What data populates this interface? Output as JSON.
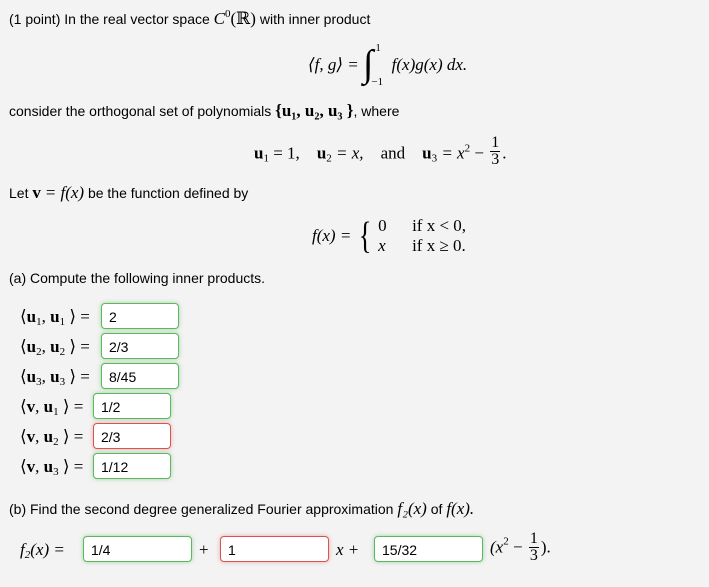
{
  "problem": {
    "intro": "(1 point) In the real vector space",
    "space": "C",
    "space_sup": "0",
    "space_arg": "(ℝ)",
    "intro_tail": "with inner product",
    "inner_product_lhs": "⟨f, g⟩ =",
    "integral_upper": "1",
    "integral_lower": "−1",
    "integrand": "f(x)g(x) dx.",
    "consider_text": "consider the orthogonal set of polynomials",
    "set_text": "{u₁, u₂, u₃ }",
    "where_text": ", where",
    "u1_def": "= 1,",
    "u2_def": "= x,",
    "and_text": "and",
    "u3_def_pre": "= x",
    "u3_def_minus": "−",
    "frac_num": "1",
    "frac_den": "3",
    "let_text_pre": "Let",
    "let_v": "v",
    "let_eq": "= f(x)",
    "let_text_post": "be the function defined by",
    "fx_lhs": "f(x) =",
    "case1_val": "0",
    "case1_cond": "if x < 0,",
    "case2_val": "x",
    "case2_cond": "if x ≥ 0."
  },
  "part_a": {
    "heading": "(a) Compute the following inner products.",
    "rows": [
      {
        "left": "u",
        "left_sub": "1",
        "right": "u",
        "right_sub": "1",
        "value": "2",
        "status": "correct"
      },
      {
        "left": "u",
        "left_sub": "2",
        "right": "u",
        "right_sub": "2",
        "value": "2/3",
        "status": "correct"
      },
      {
        "left": "u",
        "left_sub": "3",
        "right": "u",
        "right_sub": "3",
        "value": "8/45",
        "status": "correct"
      },
      {
        "left": "v",
        "left_sub": "",
        "right": "u",
        "right_sub": "1",
        "value": "1/2",
        "status": "correct"
      },
      {
        "left": "v",
        "left_sub": "",
        "right": "u",
        "right_sub": "2",
        "value": "2/3",
        "status": "incorrect"
      },
      {
        "left": "v",
        "left_sub": "",
        "right": "u",
        "right_sub": "3",
        "value": "1/12",
        "status": "correct"
      }
    ]
  },
  "part_b": {
    "heading_pre": "(b) Find the second degree generalized Fourier approximation",
    "heading_f2": "f₂(x)",
    "heading_of": "of",
    "heading_fx": "f(x).",
    "lhs": "f",
    "lhs_sub": "2",
    "lhs_tail": "(x) =",
    "plus1": "+",
    "x_plus": "x +",
    "tail_pre": "(x",
    "tail_sup": "2",
    "tail_minus": "−",
    "tail_num": "1",
    "tail_den": "3",
    "tail_close": ").",
    "answers": [
      {
        "value": "1/4",
        "status": "correct"
      },
      {
        "value": "1",
        "status": "incorrect"
      },
      {
        "value": "15/32",
        "status": "correct"
      }
    ]
  },
  "colors": {
    "correct_border": "#5cb85c",
    "incorrect_border": "#d9534f",
    "background": "#f3f3f3"
  }
}
